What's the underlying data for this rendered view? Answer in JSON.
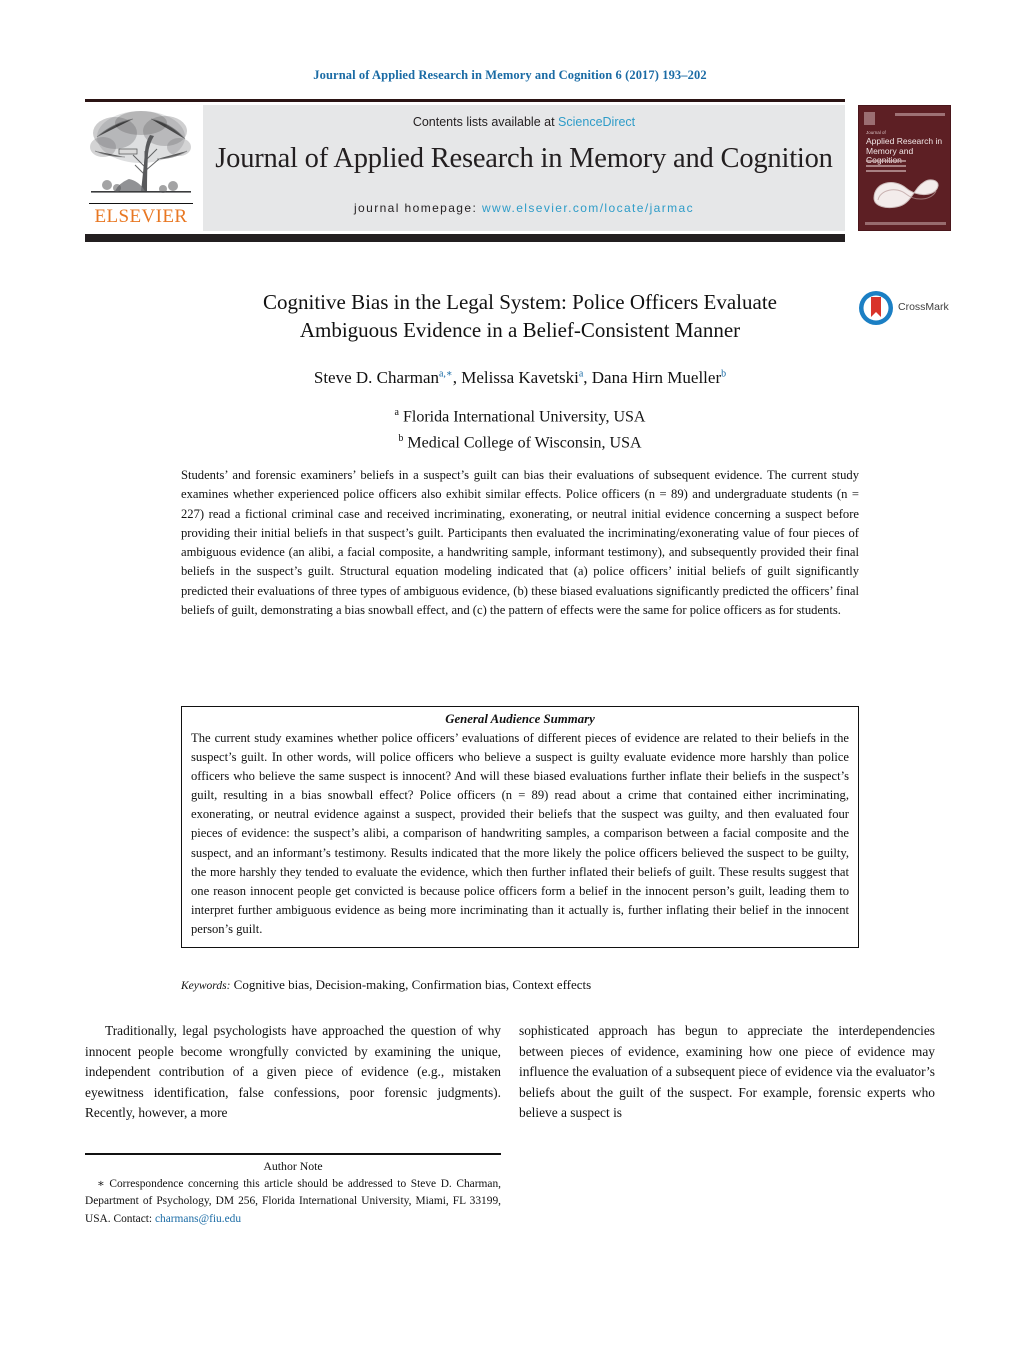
{
  "running_head": "Journal of Applied Research in Memory and Cognition 6 (2017) 193–202",
  "masthead": {
    "publisher_name": "ELSEVIER",
    "publisher_logo_icon": "elsevier-tree-icon",
    "contents_prefix": "Contents lists available at",
    "contents_link": "ScienceDirect",
    "journal_title": "Journal of Applied Research in Memory and Cognition",
    "homepage_prefix": "journal homepage:",
    "homepage_url": "www.elsevier.com/locate/jarmac",
    "cover": {
      "line1": "Journal of",
      "line2": "Applied Research in Memory and Cognition",
      "icon": "journal-cover-mobius-icon"
    }
  },
  "article": {
    "title_line1": "Cognitive Bias in the Legal System: Police Officers Evaluate",
    "title_line2": "Ambiguous Evidence in a Belief-Consistent Manner",
    "crossmark": {
      "label": "CrossMark",
      "icon": "crossmark-icon"
    },
    "authors": [
      {
        "name": "Steve D. Charman",
        "marks": "a,∗"
      },
      {
        "name": "Melissa Kavetski",
        "marks": "a"
      },
      {
        "name": "Dana Hirn Mueller",
        "marks": "b"
      }
    ],
    "authors_line": "Steve D. Charman",
    "affiliations": [
      {
        "mark": "a",
        "text": "Florida International University, USA"
      },
      {
        "mark": "b",
        "text": "Medical College of Wisconsin, USA"
      }
    ],
    "abstract": "Students’ and forensic examiners’ beliefs in a suspect’s guilt can bias their evaluations of subsequent evidence. The current study examines whether experienced police officers also exhibit similar effects. Police officers (n = 89) and undergraduate students (n = 227) read a fictional criminal case and received incriminating, exonerating, or neutral initial evidence concerning a suspect before providing their initial beliefs in that suspect’s guilt. Participants then evaluated the incriminating/exonerating value of four pieces of ambiguous evidence (an alibi, a facial composite, a handwriting sample, informant testimony), and subsequently provided their final beliefs in the suspect’s guilt. Structural equation modeling indicated that (a) police officers’ initial beliefs of guilt significantly predicted their evaluations of three types of ambiguous evidence, (b) these biased evaluations significantly predicted the officers’ final beliefs of guilt, demonstrating a bias snowball effect, and (c) the pattern of effects were the same for police officers as for students.",
    "general_audience_summary": {
      "title": "General Audience Summary",
      "body": "The current study examines whether police officers’ evaluations of different pieces of evidence are related to their beliefs in the suspect’s guilt. In other words, will police officers who believe a suspect is guilty evaluate evidence more harshly than police officers who believe the same suspect is innocent? And will these biased evaluations further inflate their beliefs in the suspect’s guilt, resulting in a bias snowball effect? Police officers (n = 89) read about a crime that contained either incriminating, exonerating, or neutral evidence against a suspect, provided their beliefs that the suspect was guilty, and then evaluated four pieces of evidence: the suspect’s alibi, a comparison of handwriting samples, a comparison between a facial composite and the suspect, and an informant’s testimony. Results indicated that the more likely the police officers believed the suspect to be guilty, the more harshly they tended to evaluate the evidence, which then further inflated their beliefs of guilt. These results suggest that one reason innocent people get convicted is because police officers form a belief in the innocent person’s guilt, leading them to interpret further ambiguous evidence as being more incriminating than it actually is, further inflating their belief in the innocent person’s guilt."
    },
    "keywords_label": "Keywords:",
    "keywords_value": "Cognitive bias, Decision-making, Confirmation bias, Context effects",
    "body_column_left": "Traditionally, legal psychologists have approached the question of why innocent people become wrongfully convicted by examining the unique, independent contribution of a given piece of evidence (e.g., mistaken eyewitness identification, false confessions, poor forensic judgments). Recently, however, a more",
    "body_column_right": "sophisticated approach has begun to appreciate the interdependencies between pieces of evidence, examining how one piece of evidence may influence the evaluation of a subsequent piece of evidence via the evaluator’s beliefs about the guilt of the suspect. For example, forensic experts who believe a suspect is"
  },
  "footnote": {
    "title": "Author Note",
    "body_before_email": "∗ Correspondence concerning this article should be addressed to Steve D. Charman, Department of Psychology, DM 256, Florida International University, Miami, FL 33199, USA. Contact: ",
    "email": "charmans@fiu.edu"
  },
  "colors": {
    "link_blue": "#1a6ba5",
    "sciencedirect_blue": "#2e9cc8",
    "elsevier_orange": "#e87722",
    "cover_maroon": "#5d1f24",
    "rule_dark": "#231f20",
    "crossmark_blue": "#1b7fc4",
    "crossmark_red": "#d9342b"
  }
}
